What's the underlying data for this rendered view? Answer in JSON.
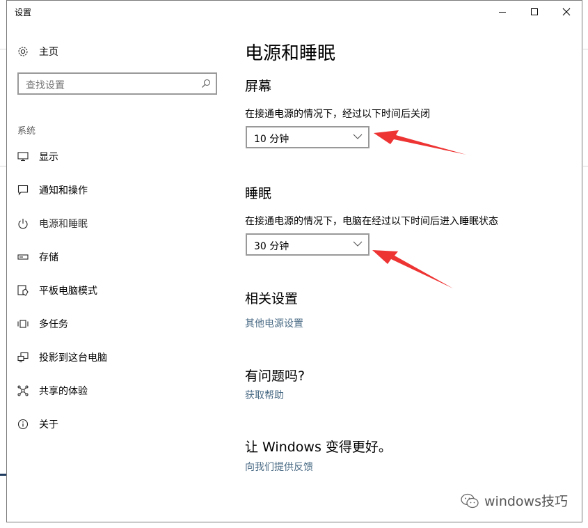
{
  "window": {
    "title": "设置",
    "controls": {
      "minimize_icon": "minimize-icon",
      "maximize_icon": "maximize-icon",
      "close_icon": "close-icon"
    }
  },
  "sidebar": {
    "home": {
      "icon": "gear-icon",
      "label": "主页"
    },
    "search": {
      "placeholder": "查找设置",
      "icon": "search-icon"
    },
    "section": "系统",
    "items": [
      {
        "icon": "display-icon",
        "label": "显示",
        "selected": false
      },
      {
        "icon": "notification-icon",
        "label": "通知和操作",
        "selected": false
      },
      {
        "icon": "power-icon",
        "label": "电源和睡眠",
        "selected": true
      },
      {
        "icon": "storage-icon",
        "label": "存储",
        "selected": false
      },
      {
        "icon": "tablet-mode-icon",
        "label": "平板电脑模式",
        "selected": false
      },
      {
        "icon": "multitasking-icon",
        "label": "多任务",
        "selected": false
      },
      {
        "icon": "project-icon",
        "label": "投影到这台电脑",
        "selected": false
      },
      {
        "icon": "shared-experience-icon",
        "label": "共享的体验",
        "selected": false
      },
      {
        "icon": "info-icon",
        "label": "关于",
        "selected": false
      }
    ]
  },
  "main": {
    "title": "电源和睡眠",
    "screen": {
      "heading": "屏幕",
      "description": "在接通电源的情况下，经过以下时间后关闭",
      "selected_value": "10 分钟"
    },
    "sleep": {
      "heading": "睡眠",
      "description": "在接通电源的情况下，电脑在经过以下时间后进入睡眠状态",
      "selected_value": "30 分钟"
    },
    "related": {
      "heading": "相关设置",
      "link": "其他电源设置"
    },
    "help": {
      "heading": "有问题吗?",
      "link": "获取帮助"
    },
    "feedback": {
      "heading": "让 Windows 变得更好。",
      "link": "向我们提供反馈"
    }
  },
  "colors": {
    "link": "#4a6b85",
    "annotation_arrow": "#ee3333",
    "border": "#999999"
  },
  "watermark": {
    "icon": "wechat-icon",
    "text": "windows技巧"
  }
}
